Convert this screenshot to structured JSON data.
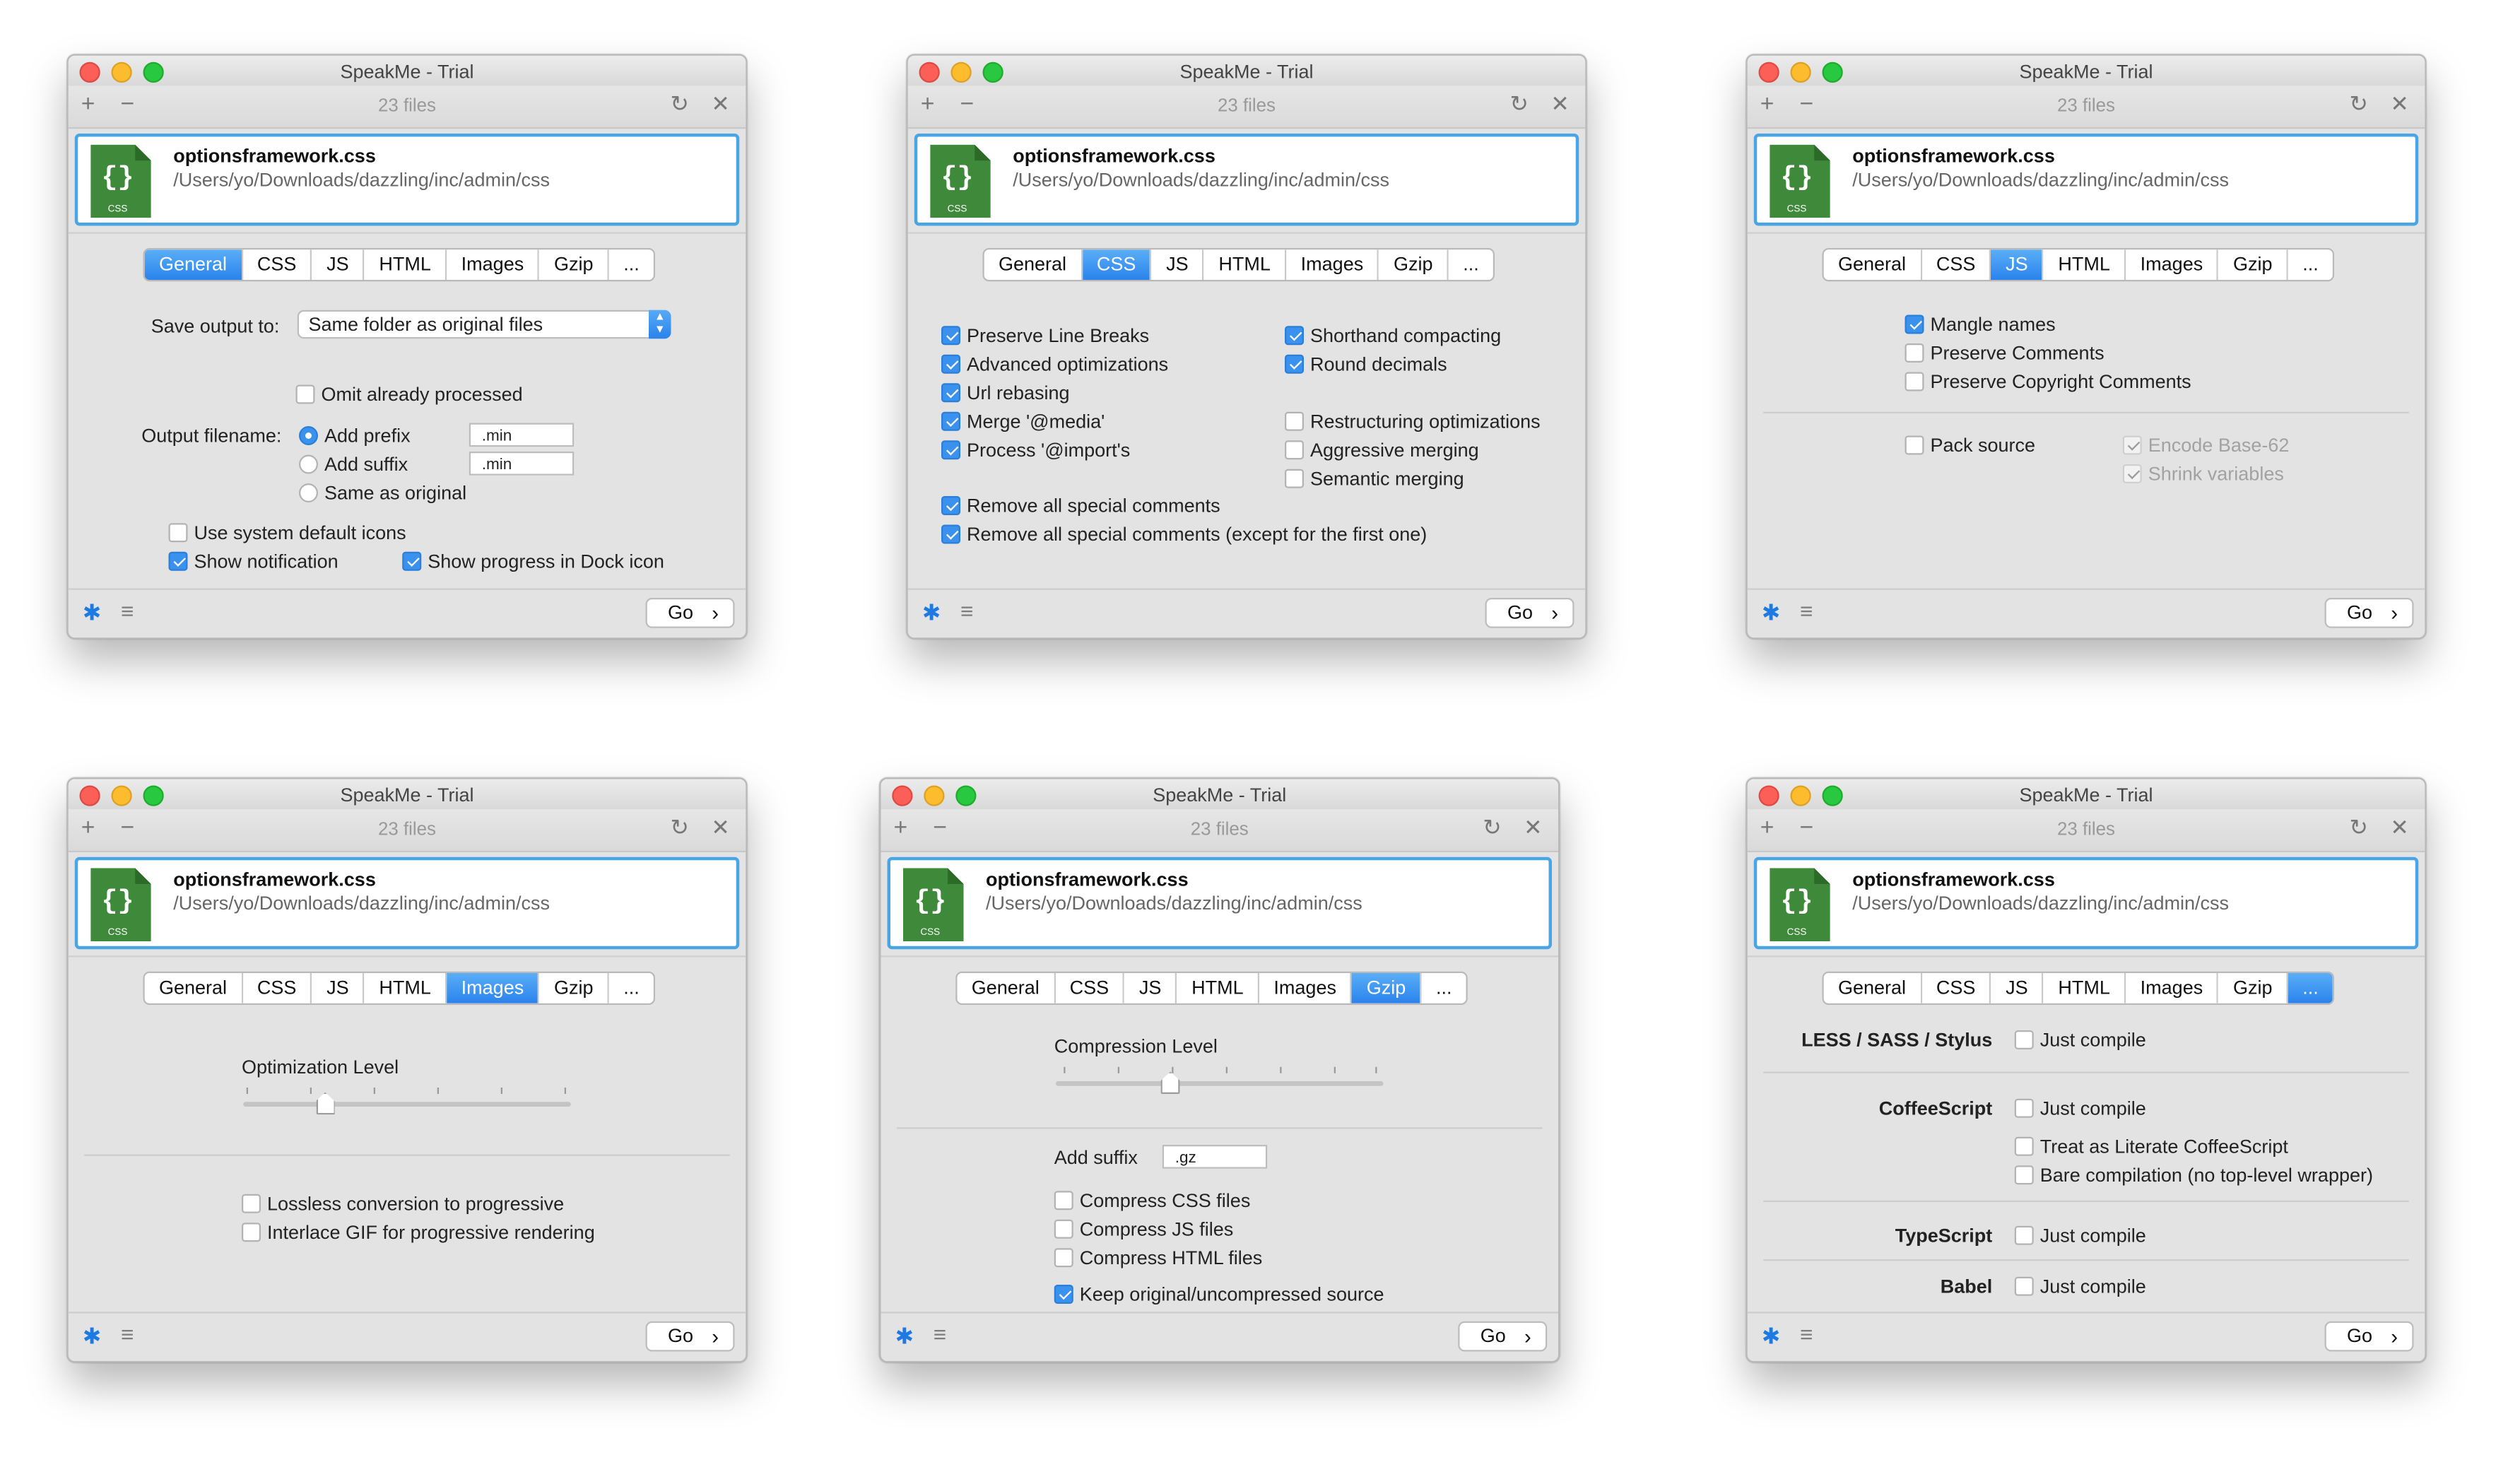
{
  "app": {
    "title": "SpeakMe - Trial",
    "files_count": "23 files",
    "file_name": "optionsframework.css",
    "file_path": "/Users/yo/Downloads/dazzling/inc/admin/css",
    "file_icon_label": "CSS",
    "tabs": [
      "General",
      "CSS",
      "JS",
      "HTML",
      "Images",
      "Gzip",
      "..."
    ],
    "go_label": "Go",
    "toolbar_icons": [
      "plus-icon",
      "minus-icon",
      "refresh-icon",
      "close-icon"
    ],
    "footer_icons": [
      "gear-icon",
      "list-icon"
    ],
    "accent_color": "#2a83ed",
    "file_icon_color": "#3f8a3a"
  },
  "general": {
    "save_output_label": "Save output to:",
    "save_output_value": "Same folder as original files",
    "omit_processed": "Omit already processed",
    "output_filename_label": "Output filename:",
    "add_prefix": "Add prefix",
    "prefix_value": ".min",
    "add_suffix": "Add suffix",
    "suffix_value": ".min",
    "same_as_original": "Same as original",
    "use_system_icons": "Use system default icons",
    "show_notification": "Show notification",
    "show_progress": "Show progress in Dock icon"
  },
  "css": {
    "preserve_line_breaks": "Preserve Line Breaks",
    "advanced_optimizations": "Advanced optimizations",
    "url_rebasing": "Url rebasing",
    "merge_media": "Merge '@media'",
    "process_import": "Process '@import's",
    "shorthand_compacting": "Shorthand compacting",
    "round_decimals": "Round decimals",
    "restructuring": "Restructuring optimizations",
    "aggressive_merging": "Aggressive merging",
    "semantic_merging": "Semantic merging",
    "remove_all_special": "Remove all special comments",
    "remove_all_special_except": "Remove all special comments (except for the first one)"
  },
  "js": {
    "mangle_names": "Mangle names",
    "preserve_comments": "Preserve Comments",
    "preserve_copyright": "Preserve Copyright Comments",
    "pack_source": "Pack source",
    "encode_base62": "Encode Base-62",
    "shrink_variables": "Shrink variables"
  },
  "images": {
    "optimization_level": "Optimization Level",
    "optimization_value": 0.25,
    "lossless_progressive": "Lossless conversion to progressive",
    "interlace_gif": "Interlace GIF for progressive rendering"
  },
  "gzip": {
    "compression_level": "Compression Level",
    "compression_value": 0.35,
    "add_suffix": "Add suffix",
    "suffix_value": ".gz",
    "compress_css": "Compress CSS files",
    "compress_js": "Compress JS files",
    "compress_html": "Compress HTML files",
    "keep_original": "Keep original/uncompressed source"
  },
  "more": {
    "less_sass": "LESS / SASS / Stylus",
    "coffeescript": "CoffeeScript",
    "typescript": "TypeScript",
    "babel": "Babel",
    "just_compile": "Just compile",
    "literate_coffee": "Treat as Literate CoffeeScript",
    "bare_compilation": "Bare compilation (no top-level wrapper)"
  }
}
